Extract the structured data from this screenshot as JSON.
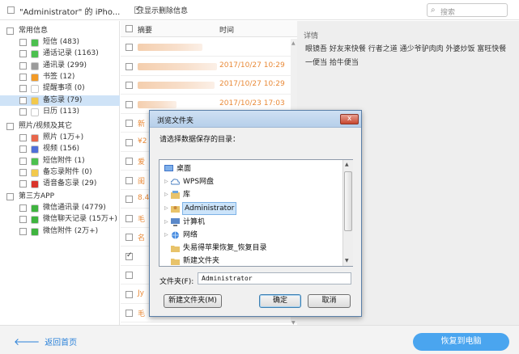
{
  "topbar": {
    "device_title": "\"Administrator\" 的 iPho...",
    "only_deleted_label": "只显示删除信息",
    "search_placeholder": "搜索"
  },
  "tree": {
    "common_group": "常用信息",
    "common_items": [
      {
        "label": "短信 (483)",
        "color": "#4cc04f"
      },
      {
        "label": "通话记录 (1163)",
        "color": "#4cc04f"
      },
      {
        "label": "通讯录 (299)",
        "color": "#9b9b9b"
      },
      {
        "label": "书签 (12)",
        "color": "#f29a26"
      },
      {
        "label": "提醒事项 (0)",
        "color": "#ffffff"
      },
      {
        "label": "备忘录 (79)",
        "color": "#f2c94c"
      },
      {
        "label": "日历 (113)",
        "color": "#ffffff"
      }
    ],
    "media_group": "照片/视频及其它",
    "media_items": [
      {
        "label": "照片 (1万+)",
        "color": "#e8664b"
      },
      {
        "label": "视频 (156)",
        "color": "#4f6fd8"
      },
      {
        "label": "短信附件 (1)",
        "color": "#4cc04f"
      },
      {
        "label": "备忘录附件 (0)",
        "color": "#f2c94c"
      },
      {
        "label": "语音备忘录 (29)",
        "color": "#d9342b"
      }
    ],
    "third_group": "第三方APP",
    "third_items": [
      {
        "label": "微信通讯录 (4779)",
        "color": "#3fb43f"
      },
      {
        "label": "微信聊天记录 (15万+)",
        "color": "#3fb43f"
      },
      {
        "label": "微信附件 (2万+)",
        "color": "#3fb43f"
      }
    ]
  },
  "list": {
    "col_summary": "摘要",
    "col_time": "时间",
    "rows": [
      {
        "text": "",
        "time": ""
      },
      {
        "text": "",
        "time": "2017/10/27 10:29"
      },
      {
        "text": "",
        "time": "2017/10/27 10:29"
      },
      {
        "text": "",
        "time": "2017/10/23 17:03"
      },
      {
        "text": "新",
        "time": ""
      },
      {
        "text": "¥2",
        "time": ""
      },
      {
        "text": "爱",
        "time": ""
      },
      {
        "text": "闺",
        "time": ""
      },
      {
        "text": "8.4",
        "time": ""
      },
      {
        "text": "毛",
        "time": ""
      },
      {
        "text": "名",
        "time": ""
      },
      {
        "text": "",
        "time": ""
      },
      {
        "text": "",
        "time": ""
      },
      {
        "text": "Jy",
        "time": ""
      },
      {
        "text": "毛",
        "time": ""
      },
      {
        "text": "毛",
        "time": ""
      }
    ]
  },
  "detail": {
    "title": "详情",
    "body": "眼镜吾 好友来快餐 行者之道 通少爷驴肉肉 外婆炒饭 富旺快餐 一便当 拾牛便当"
  },
  "bottom": {
    "back_label": "返回首页",
    "recover_label": "恢复到电脑"
  },
  "dialog": {
    "title": "浏览文件夹",
    "close_label": "x",
    "prompt": "请选择数据保存的目录：",
    "nodes": {
      "desktop": "桌面",
      "wps": "WPS网盘",
      "library": "库",
      "admin": "Administrator",
      "computer": "计算机",
      "network": "网络",
      "recovery": "失易得苹果恢复_恢复目录",
      "newfolder": "新建文件夹"
    },
    "folder_label": "文件夹(F):",
    "folder_value": "Administrator",
    "new_folder_button": "新建文件夹(M)",
    "ok_button": "确定",
    "cancel_button": "取消"
  }
}
